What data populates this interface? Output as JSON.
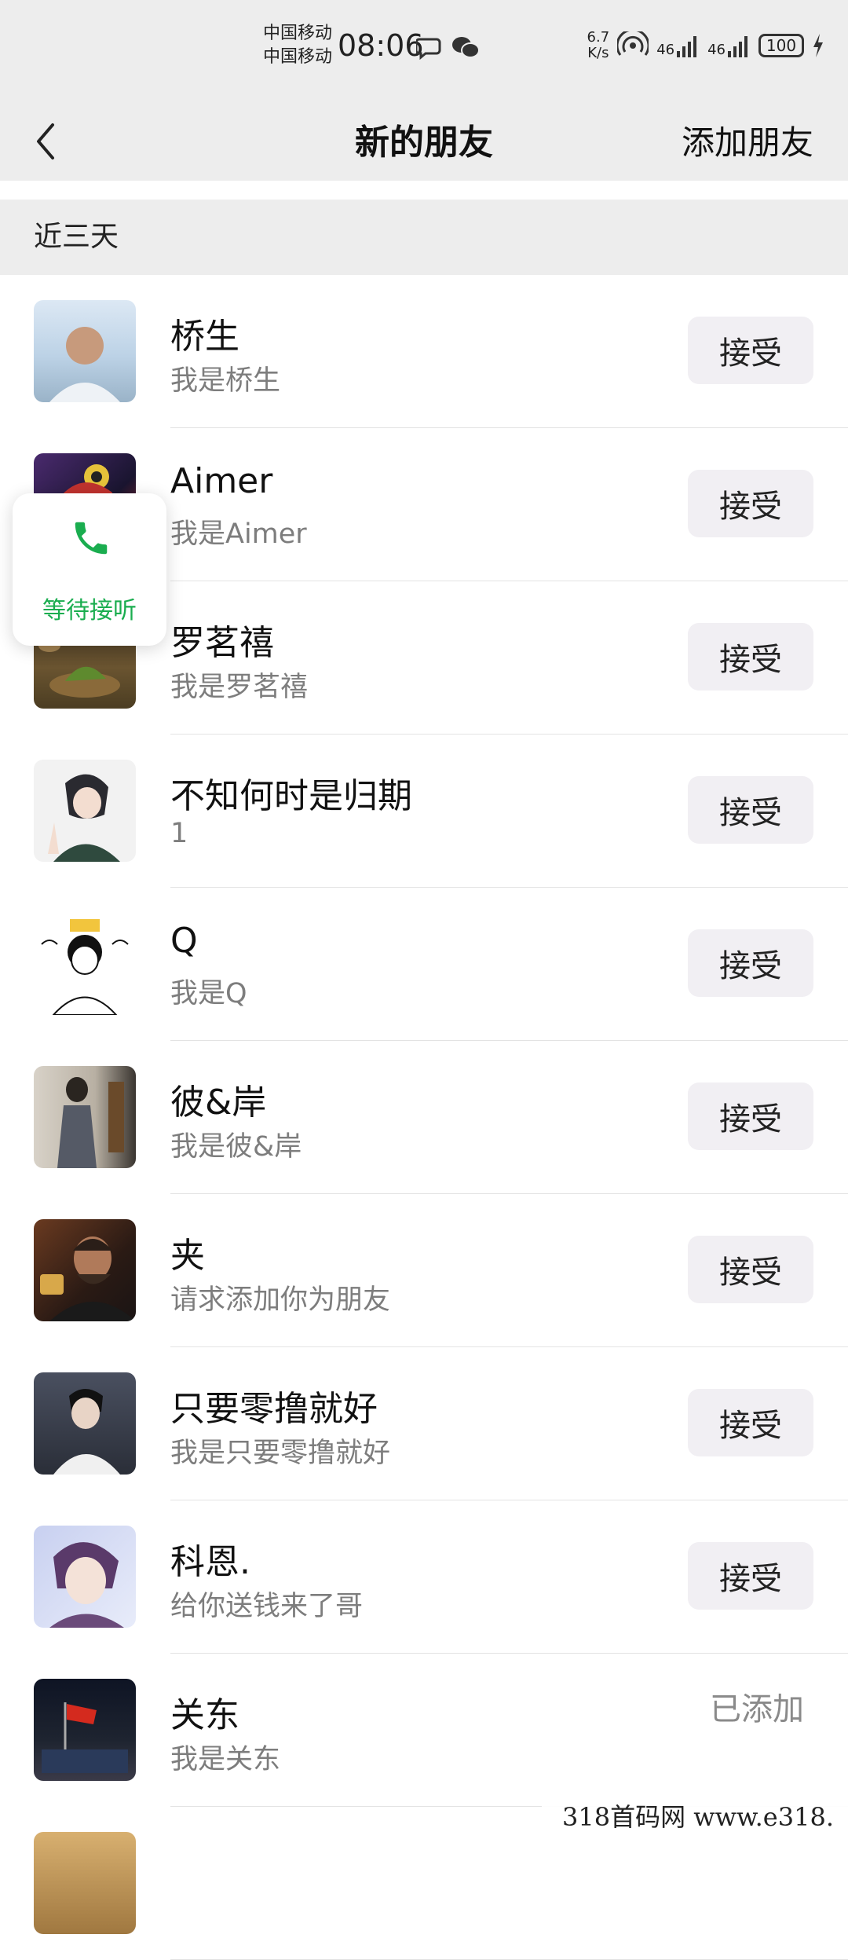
{
  "status_bar": {
    "carrier1": "中国移动",
    "carrier2": "中国移动",
    "time": "08:06",
    "speed_value": "6.7",
    "speed_unit": "K/s",
    "signal_label_1": "46",
    "signal_label_2": "46",
    "battery": "100"
  },
  "header": {
    "title": "新的朋友",
    "add_label": "添加朋友"
  },
  "section": {
    "label": "近三天"
  },
  "requests": [
    {
      "name": "桥生",
      "message": "我是桥生",
      "action": "接受"
    },
    {
      "name": "Aimer",
      "message": "我是Aimer",
      "action": "接受"
    },
    {
      "name": "罗茗禧",
      "message": "我是罗茗禧",
      "action": "接受"
    },
    {
      "name": "不知何时是归期",
      "message": "1",
      "action": "接受"
    },
    {
      "name": "Q",
      "message": "我是Q",
      "action": "接受"
    },
    {
      "name": "彼&岸",
      "message": "我是彼&岸",
      "action": "接受"
    },
    {
      "name": "夹",
      "message": "请求添加你为朋友",
      "action": "接受"
    },
    {
      "name": "只要零撸就好",
      "message": "我是只要零撸就好",
      "action": "接受"
    },
    {
      "name": "科恩.",
      "message": "给你送钱来了哥",
      "action": "接受"
    },
    {
      "name": "关东",
      "message": "我是关东",
      "status": "已添加"
    }
  ],
  "call_widget": {
    "label": "等待接听"
  },
  "watermark": "318首码网 www.e318."
}
